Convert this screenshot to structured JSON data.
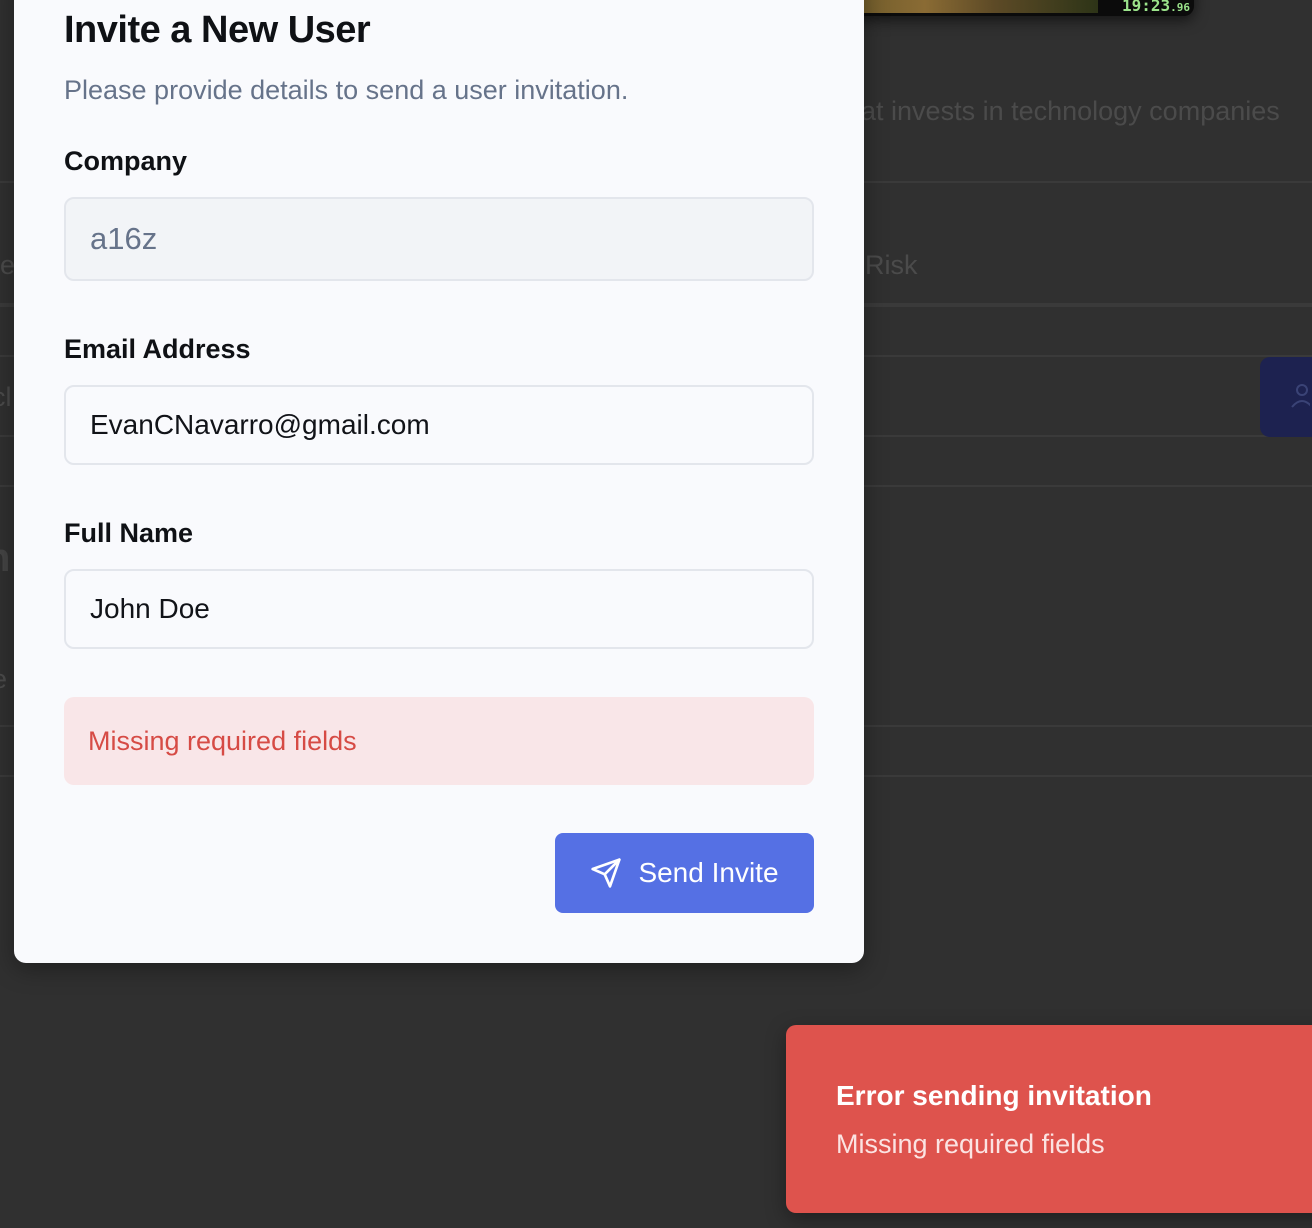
{
  "background": {
    "description_fragment": "hat invests in technology companies",
    "column_header_fragment": "Risk",
    "left_fragments": [
      "ie",
      "cl",
      "n",
      "e"
    ]
  },
  "video": {
    "timer_main": "19:23",
    "timer_fraction": ".96"
  },
  "modal": {
    "title": "Invite a New User",
    "subtitle": "Please provide details to send a user invitation.",
    "fields": {
      "company": {
        "label": "Company",
        "value": "a16z"
      },
      "email": {
        "label": "Email Address",
        "value": "EvanCNavarro@gmail.com"
      },
      "full_name": {
        "label": "Full Name",
        "value": "John Doe"
      }
    },
    "error_message": "Missing required fields",
    "submit_label": "Send Invite",
    "submit_icon": "send-icon"
  },
  "toast": {
    "title": "Error sending invitation",
    "message": "Missing required fields"
  },
  "colors": {
    "backdrop": "#303030",
    "accent": "#5570e4",
    "error_bg": "#f9e6e8",
    "error_text": "#d64b45",
    "toast_bg": "#de534d"
  }
}
